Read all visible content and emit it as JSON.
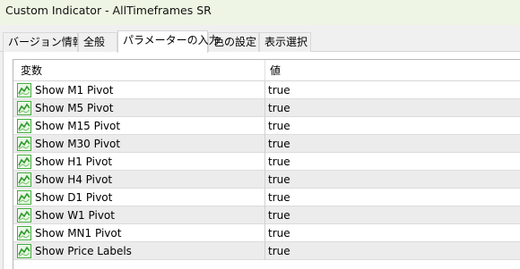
{
  "window": {
    "title": "Custom Indicator - AllTimeframes SR"
  },
  "tabs": [
    {
      "label": "バージョン情報",
      "active": false
    },
    {
      "label": "全般",
      "active": false
    },
    {
      "label": "パラメーターの入力",
      "active": true
    },
    {
      "label": "色の設定",
      "active": false
    },
    {
      "label": "表示選択",
      "active": false
    }
  ],
  "grid": {
    "columns": {
      "variable": "変数",
      "value": "値"
    },
    "row_icon": "green-chart-icon",
    "rows": [
      {
        "name": "Show M1 Pivot",
        "value": "true"
      },
      {
        "name": "Show M5 Pivot",
        "value": "true"
      },
      {
        "name": "Show M15 Pivot",
        "value": "true"
      },
      {
        "name": "Show M30 Pivot",
        "value": "true"
      },
      {
        "name": "Show H1 Pivot",
        "value": "true"
      },
      {
        "name": "Show H4 Pivot",
        "value": "true"
      },
      {
        "name": "Show D1 Pivot",
        "value": "true"
      },
      {
        "name": "Show W1 Pivot",
        "value": "true"
      },
      {
        "name": "Show MN1 Pivot",
        "value": "true"
      },
      {
        "name": "Show Price Labels",
        "value": "true"
      }
    ]
  },
  "colors": {
    "icon_green": "#3fae3a",
    "row_alt": "#ececec",
    "titlebar": "#eef5e4"
  }
}
